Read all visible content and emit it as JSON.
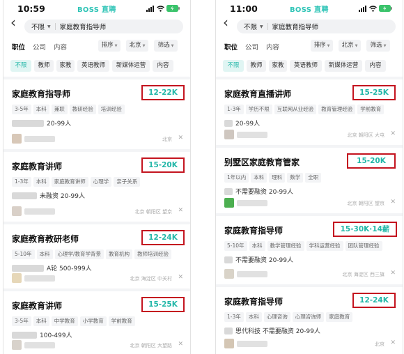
{
  "colors": {
    "accent": "#23b7a8",
    "highlight_box": "#c4141f"
  },
  "phones": [
    {
      "status": {
        "time": "10:59",
        "brand": "BOSS 直聘"
      },
      "search": {
        "city": "不限",
        "query": "家庭教育指导师"
      },
      "tabs": [
        "职位",
        "公司",
        "内容"
      ],
      "filters": [
        "排序",
        "北京",
        "筛选"
      ],
      "chips": [
        "不限",
        "教师",
        "家教",
        "英语教师",
        "新媒体运营",
        "内容"
      ],
      "jobs": [
        {
          "title": "家庭教育指导师",
          "salary": "12-22K",
          "tags": [
            "3-5年",
            "本科",
            "兼职",
            "教研经验",
            "培训经验"
          ],
          "company": "20-99人",
          "location": "北京"
        },
        {
          "title": "家庭教育讲师",
          "salary": "15-20K",
          "tags": [
            "1-3年",
            "本科",
            "家庭教育讲师",
            "心理学",
            "亲子关系"
          ],
          "company": "未融资 20-99人",
          "location": "北京 朝阳区 望京"
        },
        {
          "title": "家庭教育教研老师",
          "salary": "12-24K",
          "tags": [
            "5-10年",
            "本科",
            "心理学/教育学背景",
            "教育机构",
            "教师培训经验"
          ],
          "company": "A轮 500-999人",
          "location": "北京 海淀区 中关村"
        },
        {
          "title": "家庭教育讲师",
          "salary": "15-25K",
          "tags": [
            "3-5年",
            "本科",
            "中学教育",
            "小学教育",
            "学前教育"
          ],
          "company": "100-499人",
          "location": "北京 朝阳区 大望路"
        }
      ]
    },
    {
      "status": {
        "time": "11:00",
        "brand": "BOSS 直聘"
      },
      "search": {
        "city": "不限",
        "query": "家庭教育指导师"
      },
      "tabs": [
        "职位",
        "公司",
        "内容"
      ],
      "filters": [
        "排序",
        "北京",
        "筛选"
      ],
      "chips": [
        "不限",
        "教师",
        "家教",
        "英语教师",
        "新媒体运营",
        "内容"
      ],
      "jobs": [
        {
          "title": "家庭教育直播讲师",
          "salary": "15-25K",
          "tags": [
            "1-3年",
            "学历不限",
            "互联网从业经验",
            "教育管理经验",
            "学前教育"
          ],
          "company": "20-99人",
          "location": "北京 朝阳区 大屯"
        },
        {
          "title": "别墅区家庭教育管家",
          "salary": "15-20K",
          "tags": [
            "1年以内",
            "本科",
            "理科",
            "数学",
            "全职"
          ],
          "company": "不需要融资 20-99人",
          "location": "北京 朝阳区 望京"
        },
        {
          "title": "家庭教育指导师",
          "salary": "15-30K·14薪",
          "tags": [
            "5-10年",
            "本科",
            "教学管理经验",
            "学科运营经验",
            "团队管理经验"
          ],
          "company": "不需要融资 20-99人",
          "location": "北京 海淀区 西三旗"
        },
        {
          "title": "家庭教育指导师",
          "salary": "12-24K",
          "tags": [
            "1-3年",
            "本科",
            "心理咨询",
            "心理咨询师",
            "家庭教育"
          ],
          "company": "思代科技 不需要融资 20-99人",
          "location": "北京"
        }
      ]
    }
  ]
}
